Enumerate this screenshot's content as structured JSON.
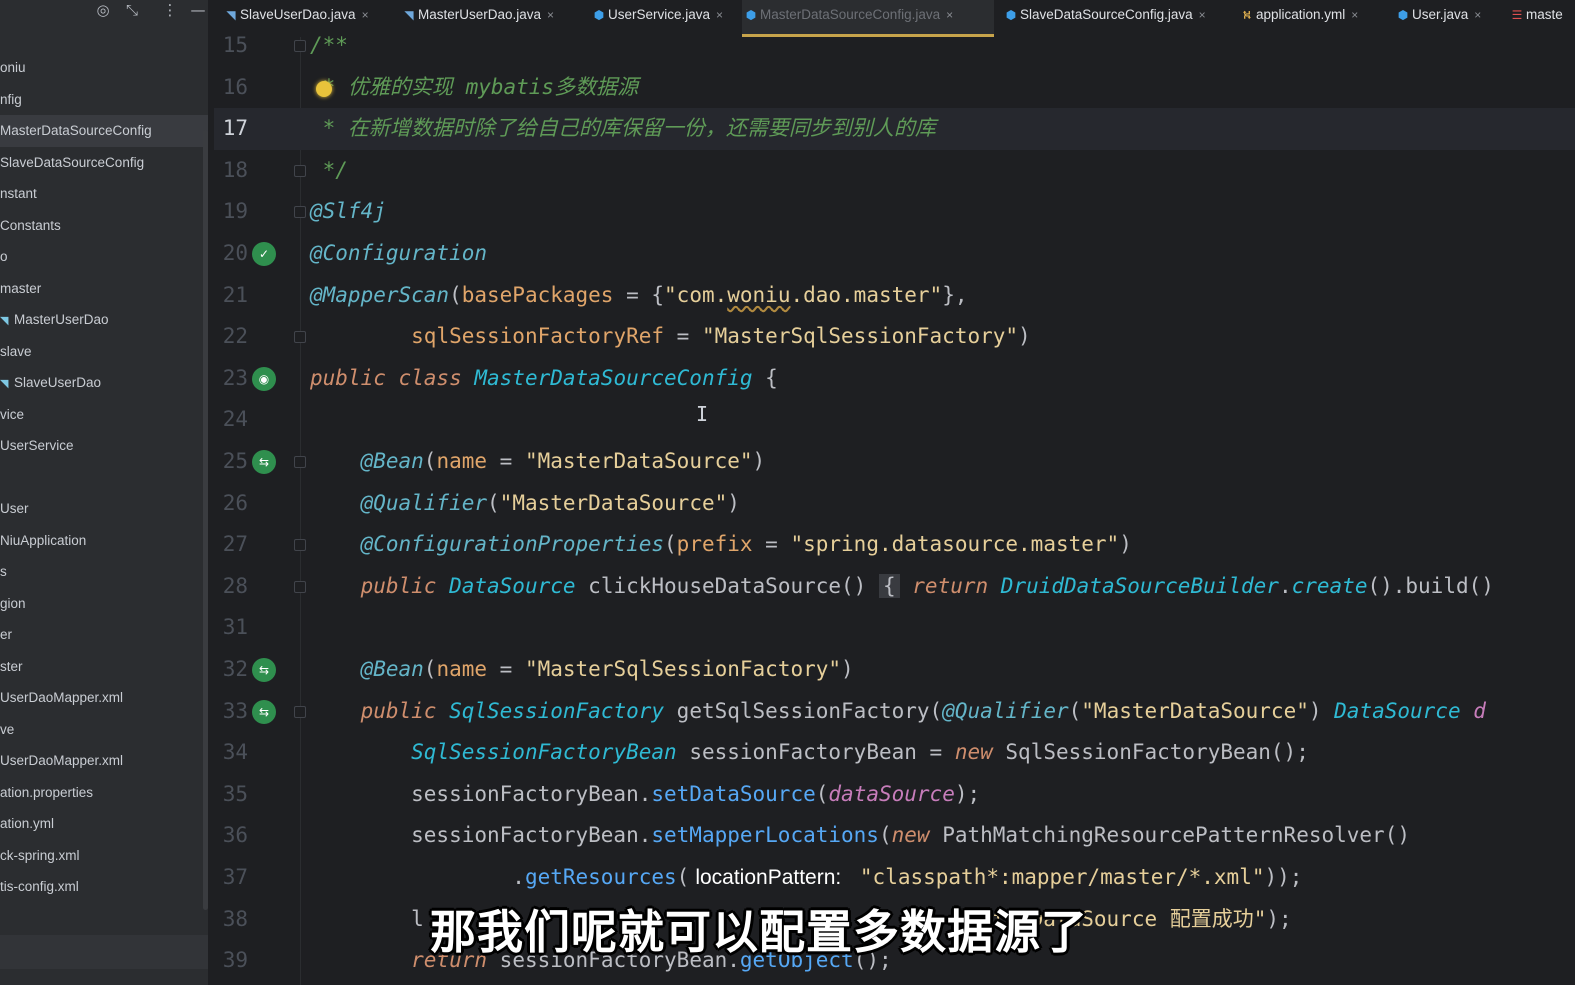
{
  "sidebar": {
    "toolbar_icons": [
      "target-icon",
      "collapse-icon",
      "more-icon",
      "minimize-icon"
    ],
    "toolbar_glyphs": [
      "◎",
      "⤡",
      "⋮",
      "—"
    ],
    "items": [
      {
        "label": "oniu"
      },
      {
        "label": "nfig"
      },
      {
        "label": "MasterDataSourceConfig",
        "selected": true
      },
      {
        "label": "SlaveDataSourceConfig"
      },
      {
        "label": "nstant"
      },
      {
        "label": "Constants"
      },
      {
        "label": "o"
      },
      {
        "label": "master"
      },
      {
        "label": "MasterUserDao",
        "icon": true
      },
      {
        "label": "slave"
      },
      {
        "label": "SlaveUserDao",
        "icon": true
      },
      {
        "label": "vice"
      },
      {
        "label": "UserService"
      },
      {
        "label": ""
      },
      {
        "label": "User"
      },
      {
        "label": "NiuApplication"
      },
      {
        "label": "s"
      },
      {
        "label": "gion"
      },
      {
        "label": "er"
      },
      {
        "label": "ster"
      },
      {
        "label": "UserDaoMapper.xml"
      },
      {
        "label": "ve"
      },
      {
        "label": "UserDaoMapper.xml"
      },
      {
        "label": "ation.properties"
      },
      {
        "label": "ation.yml"
      },
      {
        "label": "ck-spring.xml"
      },
      {
        "label": "tis-config.xml"
      }
    ]
  },
  "tabs": [
    {
      "label": "SlaveUserDao.java",
      "icon": "java-interface-icon",
      "glyph": "◥",
      "color": "#6fa8dc"
    },
    {
      "label": "MasterUserDao.java",
      "icon": "java-interface-icon",
      "glyph": "◥",
      "color": "#6fa8dc"
    },
    {
      "label": "UserService.java",
      "icon": "java-class-icon",
      "glyph": "⬢",
      "color": "#3d9ee8"
    },
    {
      "label": "MasterDataSourceConfig.java",
      "icon": "java-class-icon",
      "glyph": "⬢",
      "color": "#3d9ee8",
      "active": true
    },
    {
      "label": "SlaveDataSourceConfig.java",
      "icon": "java-class-icon",
      "glyph": "⬢",
      "color": "#3d9ee8"
    },
    {
      "label": "application.yml",
      "icon": "yaml-file-icon",
      "glyph": "⛕",
      "color": "#e0b050"
    },
    {
      "label": "User.java",
      "icon": "java-class-icon",
      "glyph": "⬢",
      "color": "#3d9ee8"
    },
    {
      "label": "maste",
      "icon": "xml-file-icon",
      "glyph": "☰",
      "color": "#e05050"
    }
  ],
  "tab_close": "×",
  "editor": {
    "lines": [
      {
        "n": "15",
        "tokens": [
          [
            "comment",
            "/**"
          ]
        ]
      },
      {
        "n": "16",
        "tokens": [
          [
            "comment",
            " * 优雅的实现 mybatis多数据源"
          ]
        ]
      },
      {
        "n": "17",
        "tokens": [
          [
            "comment",
            " * 在新增数据时除了给自己的库保留一份，还需要同步到别人的库"
          ]
        ]
      },
      {
        "n": "18",
        "tokens": [
          [
            "comment",
            " */"
          ]
        ]
      },
      {
        "n": "19",
        "tokens": [
          [
            "ann",
            "@Slf4j"
          ]
        ]
      },
      {
        "n": "20",
        "tokens": [
          [
            "ann",
            "@Configuration"
          ]
        ]
      },
      {
        "n": "21",
        "tokens": [
          [
            "ann",
            "@MapperScan"
          ],
          [
            "plain",
            "("
          ],
          [
            "param",
            "basePackages"
          ],
          [
            "plain",
            " = {"
          ],
          [
            "str",
            "\"com."
          ],
          [
            "strsq",
            "woniu"
          ],
          [
            "str",
            ".dao.master\""
          ],
          [
            "plain",
            "},"
          ]
        ]
      },
      {
        "n": "22",
        "tokens": [
          [
            "plain",
            "        "
          ],
          [
            "param",
            "sqlSessionFactoryRef"
          ],
          [
            "plain",
            " = "
          ],
          [
            "str",
            "\"MasterSqlSessionFactory\""
          ],
          [
            "plain",
            ")"
          ]
        ]
      },
      {
        "n": "23",
        "tokens": [
          [
            "kw",
            "public class "
          ],
          [
            "cls",
            "MasterDataSourceConfig"
          ],
          [
            "plain",
            " {"
          ]
        ]
      },
      {
        "n": "24",
        "tokens": []
      },
      {
        "n": "25",
        "tokens": [
          [
            "plain",
            "    "
          ],
          [
            "ann",
            "@Bean"
          ],
          [
            "plain",
            "("
          ],
          [
            "param",
            "name"
          ],
          [
            "plain",
            " = "
          ],
          [
            "str",
            "\"MasterDataSource\""
          ],
          [
            "plain",
            ")"
          ]
        ]
      },
      {
        "n": "26",
        "tokens": [
          [
            "plain",
            "    "
          ],
          [
            "ann",
            "@Qualifier"
          ],
          [
            "plain",
            "("
          ],
          [
            "str",
            "\"MasterDataSource\""
          ],
          [
            "plain",
            ")"
          ]
        ]
      },
      {
        "n": "27",
        "tokens": [
          [
            "plain",
            "    "
          ],
          [
            "ann",
            "@ConfigurationProperties"
          ],
          [
            "plain",
            "("
          ],
          [
            "param",
            "prefix"
          ],
          [
            "plain",
            " = "
          ],
          [
            "str",
            "\"spring.datasource.master\""
          ],
          [
            "plain",
            ")"
          ]
        ]
      },
      {
        "n": "28",
        "tokens": [
          [
            "plain",
            "    "
          ],
          [
            "kw",
            "public "
          ],
          [
            "cls",
            "DataSource"
          ],
          [
            "plain",
            " clickHouseDataSource() "
          ],
          [
            "brace",
            "{"
          ],
          [
            "plain",
            " "
          ],
          [
            "kw",
            "return "
          ],
          [
            "cls",
            "DruidDataSourceBuilder"
          ],
          [
            "plain",
            "."
          ],
          [
            "cls",
            "create"
          ],
          [
            "plain",
            "().build()"
          ]
        ]
      },
      {
        "n": "31",
        "tokens": []
      },
      {
        "n": "32",
        "tokens": [
          [
            "plain",
            "    "
          ],
          [
            "ann",
            "@Bean"
          ],
          [
            "plain",
            "("
          ],
          [
            "param",
            "name"
          ],
          [
            "plain",
            " = "
          ],
          [
            "str",
            "\"MasterSqlSessionFactory\""
          ],
          [
            "plain",
            ")"
          ]
        ]
      },
      {
        "n": "33",
        "tokens": [
          [
            "plain",
            "    "
          ],
          [
            "kw",
            "public "
          ],
          [
            "cls",
            "SqlSessionFactory"
          ],
          [
            "plain",
            " getSqlSessionFactory("
          ],
          [
            "ann",
            "@Qualifier"
          ],
          [
            "plain",
            "("
          ],
          [
            "str",
            "\"MasterDataSource\""
          ],
          [
            "plain",
            ") "
          ],
          [
            "cls",
            "DataSource"
          ],
          [
            "plain",
            " "
          ],
          [
            "field",
            "d"
          ]
        ]
      },
      {
        "n": "34",
        "tokens": [
          [
            "plain",
            "        "
          ],
          [
            "cls",
            "SqlSessionFactoryBean"
          ],
          [
            "plain",
            " sessionFactoryBean = "
          ],
          [
            "kw",
            "new "
          ],
          [
            "plain",
            "SqlSessionFactoryBean();"
          ]
        ]
      },
      {
        "n": "35",
        "tokens": [
          [
            "plain",
            "        sessionFactoryBean."
          ],
          [
            "meth",
            "setDataSource"
          ],
          [
            "plain",
            "("
          ],
          [
            "field",
            "dataSource"
          ],
          [
            "plain",
            ");"
          ]
        ]
      },
      {
        "n": "36",
        "tokens": [
          [
            "plain",
            "        sessionFactoryBean."
          ],
          [
            "meth",
            "setMapperLocations"
          ],
          [
            "plain",
            "("
          ],
          [
            "kw",
            "new "
          ],
          [
            "plain",
            "PathMatchingResourcePatternResolver()"
          ]
        ]
      },
      {
        "n": "37",
        "tokens": [
          [
            "plain",
            "                ."
          ],
          [
            "meth",
            "getResources"
          ],
          [
            "plain",
            "("
          ],
          [
            "inlay",
            "locationPattern:"
          ],
          [
            "plain",
            " "
          ],
          [
            "str",
            "\"classpath*:mapper/master/*.xml\""
          ],
          [
            "plain",
            "));"
          ]
        ]
      },
      {
        "n": "38",
        "tokens": [
          [
            "plain",
            "        l                                           "
          ],
          [
            "str",
            "asterDataSource 配置成功\""
          ],
          [
            "plain",
            ");"
          ]
        ]
      },
      {
        "n": "39",
        "tokens": [
          [
            "plain",
            "        "
          ],
          [
            "kw",
            "return "
          ],
          [
            "plain",
            "sessionFactoryBean."
          ],
          [
            "meth",
            "getObject"
          ],
          [
            "plain",
            "();"
          ]
        ]
      }
    ],
    "current_line": "17",
    "gutter_icons": {
      "20": "spring-bean-icon",
      "23": "spring-bean-icon",
      "25": "spring-bean-icon",
      "32": "spring-bean-icon",
      "33": "spring-bean-icon"
    },
    "gutter_glyphs": {
      "20": "✓",
      "23": "◉",
      "25": "⇆",
      "32": "⇆",
      "33": "⇆"
    }
  },
  "subtitle": "那我们呢就可以配置多数据源了"
}
